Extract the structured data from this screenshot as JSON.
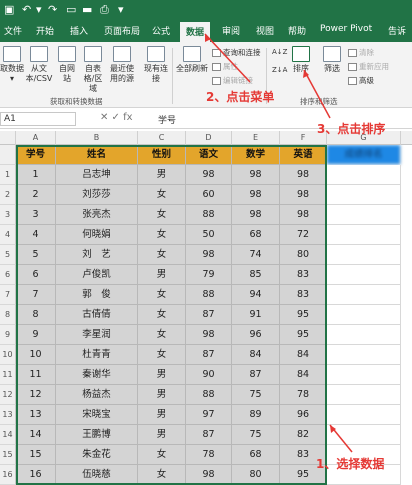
{
  "qat": {
    "file_tab": "文件"
  },
  "tabs": [
    {
      "label": "文件",
      "active": false
    },
    {
      "label": "开始",
      "active": false
    },
    {
      "label": "插入",
      "active": false
    },
    {
      "label": "页面布局",
      "active": false
    },
    {
      "label": "公式",
      "active": false
    },
    {
      "label": "数据",
      "active": true
    },
    {
      "label": "审阅",
      "active": false
    },
    {
      "label": "视图",
      "active": false
    },
    {
      "label": "帮助",
      "active": false
    },
    {
      "label": "Power Pivot",
      "active": false
    },
    {
      "label": "告诉",
      "active": false
    }
  ],
  "ribbon": {
    "get_data": {
      "btn1": "取数据 ▾",
      "btn2": "从文本/CSV",
      "btn3": "自网站",
      "btn4": "自表格/区域",
      "btn5": "最近使用的源",
      "btn6": "现有连接",
      "group": "获取和转换数据"
    },
    "queries": {
      "refresh": "全部刷新",
      "queries_conn": "查询和连接",
      "properties": "属性",
      "edit_links": "编辑链接",
      "group": "查询和连接"
    },
    "sort": {
      "sort_az": "A↓Z",
      "sort_za": "Z↓A",
      "sort": "排序",
      "filter": "筛选",
      "clear": "清除",
      "reapply": "重新应用",
      "advanced": "高级",
      "group": "排序和筛选"
    }
  },
  "formula": {
    "namebox": "A1",
    "fx": "✕ ✓ fx",
    "value": "学号"
  },
  "columns": [
    "A",
    "B",
    "C",
    "D",
    "E",
    "F",
    "G"
  ],
  "table": {
    "headers": [
      "学号",
      "姓名",
      "性别",
      "语文",
      "数学",
      "英语"
    ],
    "g_header": "成绩排名",
    "rows": [
      {
        "num": "1",
        "cells": [
          "1",
          "吕志坤",
          "男",
          "98",
          "98",
          "98"
        ]
      },
      {
        "num": "2",
        "cells": [
          "2",
          "刘莎莎",
          "女",
          "60",
          "98",
          "98"
        ]
      },
      {
        "num": "3",
        "cells": [
          "3",
          "张亮杰",
          "女",
          "88",
          "98",
          "98"
        ]
      },
      {
        "num": "4",
        "cells": [
          "4",
          "何晓娟",
          "女",
          "50",
          "68",
          "72"
        ]
      },
      {
        "num": "5",
        "cells": [
          "5",
          "刘　艺",
          "女",
          "98",
          "74",
          "80"
        ]
      },
      {
        "num": "6",
        "cells": [
          "6",
          "卢俊凯",
          "男",
          "79",
          "85",
          "83"
        ]
      },
      {
        "num": "7",
        "cells": [
          "7",
          "郭　俊",
          "女",
          "88",
          "94",
          "83"
        ]
      },
      {
        "num": "8",
        "cells": [
          "8",
          "古倩倩",
          "女",
          "87",
          "91",
          "95"
        ]
      },
      {
        "num": "9",
        "cells": [
          "9",
          "李星润",
          "女",
          "98",
          "96",
          "95"
        ]
      },
      {
        "num": "10",
        "cells": [
          "10",
          "杜青青",
          "女",
          "87",
          "84",
          "84"
        ]
      },
      {
        "num": "11",
        "cells": [
          "11",
          "秦谢华",
          "男",
          "90",
          "87",
          "84"
        ]
      },
      {
        "num": "12",
        "cells": [
          "12",
          "杨益杰",
          "男",
          "88",
          "75",
          "78"
        ]
      },
      {
        "num": "13",
        "cells": [
          "13",
          "宋晓宝",
          "男",
          "97",
          "89",
          "96"
        ]
      },
      {
        "num": "14",
        "cells": [
          "14",
          "王鹏博",
          "男",
          "87",
          "75",
          "82"
        ]
      },
      {
        "num": "15",
        "cells": [
          "15",
          "朱金花",
          "女",
          "78",
          "68",
          "83"
        ]
      },
      {
        "num": "16",
        "cells": [
          "16",
          "伍晓慈",
          "女",
          "98",
          "80",
          "95"
        ]
      },
      {
        "num": "17",
        "cells": [
          "17",
          "张艺浩",
          "女",
          "96",
          "84",
          "93"
        ]
      }
    ]
  },
  "annotations": {
    "step1": "1、选择数据",
    "step2": "2、点击菜单",
    "step3": "3、点击排序"
  },
  "colors": {
    "accent": "#217346",
    "header": "#e3a52b",
    "annotation": "#e53935",
    "selection": "#d4d4d4"
  }
}
